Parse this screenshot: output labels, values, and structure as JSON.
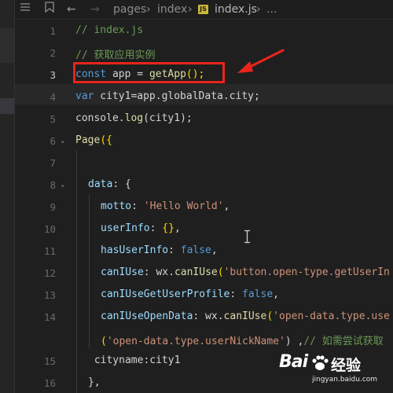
{
  "topbar": {
    "breadcrumb": [
      "pages",
      "index",
      "index.js",
      "..."
    ],
    "file_badge": "JS"
  },
  "editor": {
    "active_line": 3,
    "lines": [
      {
        "num": "1",
        "indent": 0,
        "fold": false,
        "tokens": [
          {
            "t": "// index.js",
            "c": "cm"
          }
        ]
      },
      {
        "num": "2",
        "indent": 0,
        "fold": false,
        "tokens": [
          {
            "t": "// 获取应用实例",
            "c": "cm"
          }
        ]
      },
      {
        "num": "3",
        "indent": 0,
        "fold": false,
        "tokens": [
          {
            "t": "const",
            "c": "kw"
          },
          {
            "t": " app = ",
            "c": "var"
          },
          {
            "t": "getApp",
            "c": "fn"
          },
          {
            "t": "();",
            "c": "br"
          }
        ]
      },
      {
        "num": "4",
        "indent": 0,
        "fold": false,
        "tokens": [
          {
            "t": "var",
            "c": "kw"
          },
          {
            "t": " city1=app.globalData.city;",
            "c": "var"
          }
        ]
      },
      {
        "num": "5",
        "indent": 0,
        "fold": false,
        "tokens": [
          {
            "t": "console.",
            "c": "var"
          },
          {
            "t": "log",
            "c": "fn"
          },
          {
            "t": "(city1);",
            "c": "var"
          }
        ]
      },
      {
        "num": "6",
        "indent": 0,
        "fold": true,
        "tokens": [
          {
            "t": "Page",
            "c": "fn"
          },
          {
            "t": "({",
            "c": "br"
          }
        ]
      },
      {
        "num": "7",
        "indent": 0,
        "fold": false,
        "tokens": []
      },
      {
        "num": "8",
        "indent": 1,
        "fold": true,
        "tokens": [
          {
            "t": "data",
            "c": "prop"
          },
          {
            "t": ": {",
            "c": "var"
          }
        ]
      },
      {
        "num": "9",
        "indent": 2,
        "fold": false,
        "tokens": [
          {
            "t": "motto",
            "c": "prop"
          },
          {
            "t": ": ",
            "c": "var"
          },
          {
            "t": "'Hello World'",
            "c": "str"
          },
          {
            "t": ",",
            "c": "var"
          }
        ]
      },
      {
        "num": "10",
        "indent": 2,
        "fold": false,
        "tokens": [
          {
            "t": "userInfo",
            "c": "prop"
          },
          {
            "t": ": ",
            "c": "var"
          },
          {
            "t": "{}",
            "c": "br"
          },
          {
            "t": ",",
            "c": "var"
          }
        ]
      },
      {
        "num": "11",
        "indent": 2,
        "fold": false,
        "tokens": [
          {
            "t": "hasUserInfo",
            "c": "prop"
          },
          {
            "t": ": ",
            "c": "var"
          },
          {
            "t": "false",
            "c": "bool"
          },
          {
            "t": ",",
            "c": "var"
          }
        ]
      },
      {
        "num": "12",
        "indent": 2,
        "fold": false,
        "tokens": [
          {
            "t": "canIUse",
            "c": "prop"
          },
          {
            "t": ": wx.",
            "c": "var"
          },
          {
            "t": "canIUse",
            "c": "fn"
          },
          {
            "t": "(",
            "c": "br"
          },
          {
            "t": "'button.open-type.getUserIn",
            "c": "str"
          }
        ]
      },
      {
        "num": "13",
        "indent": 2,
        "fold": false,
        "tokens": [
          {
            "t": "canIUseGetUserProfile",
            "c": "prop"
          },
          {
            "t": ": ",
            "c": "var"
          },
          {
            "t": "false",
            "c": "bool"
          },
          {
            "t": ",",
            "c": "var"
          }
        ]
      },
      {
        "num": "14",
        "indent": 2,
        "fold": false,
        "tokens": [
          {
            "t": "canIUseOpenData",
            "c": "prop"
          },
          {
            "t": ": wx.",
            "c": "var"
          },
          {
            "t": "canIUse",
            "c": "fn"
          },
          {
            "t": "(",
            "c": "br"
          },
          {
            "t": "'open-data.type.use",
            "c": "str"
          }
        ]
      },
      {
        "num": "",
        "indent": 2,
        "fold": false,
        "tokens": [
          {
            "t": "(",
            "c": "br"
          },
          {
            "t": "'open-data.type.userNickName'",
            "c": "str"
          },
          {
            "t": ") ,",
            "c": "var"
          },
          {
            "t": "// 如需尝试获取",
            "c": "cm"
          }
        ]
      },
      {
        "num": "15",
        "indent": 1,
        "fold": false,
        "tokens": [
          {
            "t": " cityname:city1",
            "c": "var"
          }
        ]
      },
      {
        "num": "16",
        "indent": 1,
        "fold": false,
        "tokens": [
          {
            "t": "},",
            "c": "var"
          }
        ]
      }
    ]
  },
  "watermark": {
    "brand_a": "Bai",
    "brand_b": "经验",
    "url": "jingyan.baidu.com"
  },
  "colors": {
    "annotation_red": "#e8251c",
    "comment": "#6a9955",
    "keyword": "#569cd6",
    "string": "#ce9178",
    "function": "#dcdcaa"
  }
}
